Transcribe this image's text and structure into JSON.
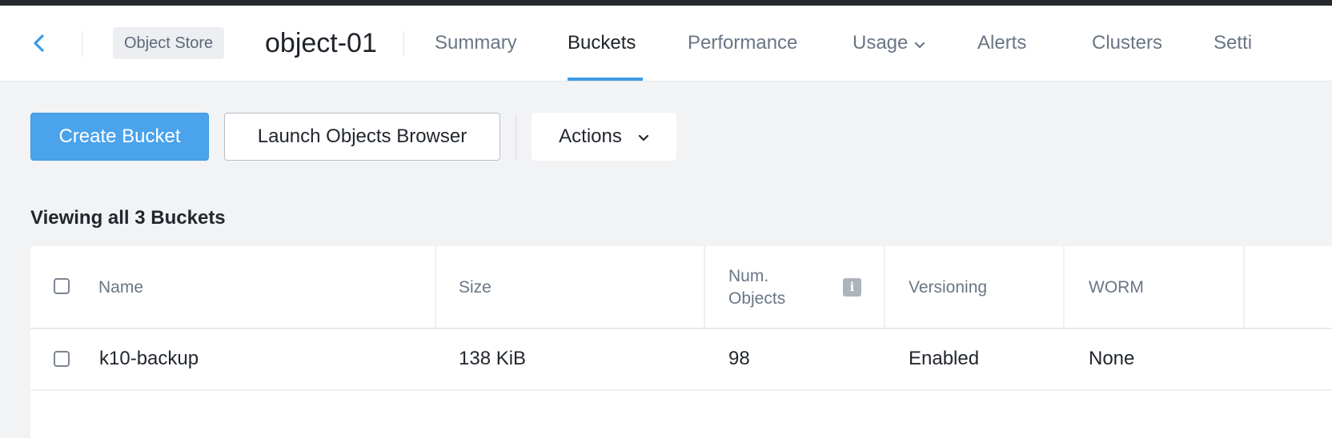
{
  "header": {
    "entity_type": "Object Store",
    "entity_name": "object-01",
    "tabs": [
      {
        "label": "Summary"
      },
      {
        "label": "Buckets"
      },
      {
        "label": "Performance"
      },
      {
        "label": "Usage"
      },
      {
        "label": "Alerts"
      },
      {
        "label": "Clusters"
      },
      {
        "label": "Setti"
      }
    ],
    "active_tab": "Buckets"
  },
  "toolbar": {
    "create_label": "Create Bucket",
    "browser_label": "Launch Objects Browser",
    "actions_label": "Actions"
  },
  "summary": {
    "viewing_text": "Viewing all 3 Buckets"
  },
  "table": {
    "columns": [
      {
        "label": "Name"
      },
      {
        "label": "Size"
      },
      {
        "label_line1": "Num.",
        "label_line2": "Objects"
      },
      {
        "label": "Versioning"
      },
      {
        "label": "WORM"
      }
    ],
    "rows": [
      {
        "name": "k10-backup",
        "size": "138 KiB",
        "num_objects": "98",
        "versioning": "Enabled",
        "worm": "None"
      }
    ]
  },
  "colors": {
    "accent": "#4aa3eb",
    "active_underline": "#3c9be6",
    "top_strip": "#25282d",
    "page_bg": "#f2f3f5"
  },
  "icons": [
    "back-chevron-icon",
    "chevron-down-icon",
    "info-icon"
  ]
}
